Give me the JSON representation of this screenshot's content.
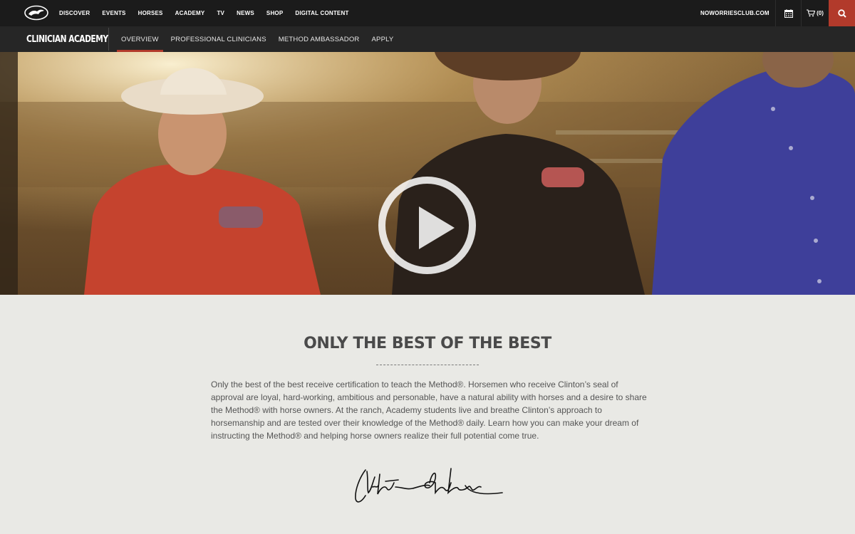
{
  "topbar": {
    "nav": [
      "DISCOVER",
      "EVENTS",
      "HORSES",
      "ACADEMY",
      "TV",
      "NEWS",
      "SHOP",
      "DIGITAL CONTENT"
    ],
    "club_link": "NOWORRIESCLUB.COM",
    "cart_count": "(0)",
    "icons": {
      "logo": "horse-logo-icon",
      "calendar": "calendar-icon",
      "cart": "cart-icon",
      "search": "search-icon"
    },
    "accent_color": "#b23a2b"
  },
  "subnav": {
    "title": "CLINICIAN ACADEMY",
    "tabs": [
      {
        "label": "OVERVIEW",
        "active": true
      },
      {
        "label": "PROFESSIONAL CLINICIANS",
        "active": false
      },
      {
        "label": "METHOD AMBASSADOR",
        "active": false
      },
      {
        "label": "APPLY",
        "active": false
      }
    ]
  },
  "hero": {
    "play_icon": "play-icon"
  },
  "content": {
    "heading": "ONLY THE BEST OF THE BEST",
    "paragraph": "Only the best of the best receive certification to teach the Method®. Horsemen who receive Clinton’s seal of approval are loyal, hard-working, ambitious and personable, have a natural ability with horses and a desire to share the Method® with horse owners. At the ranch, Academy students live and breathe Clinton’s approach to horsemanship and are tested over their knowledge of the Method® daily. Learn how you can make your dream of instructing the Method® and helping horse owners realize their full potential come true.",
    "signature_text": "Clinton Anderson"
  }
}
